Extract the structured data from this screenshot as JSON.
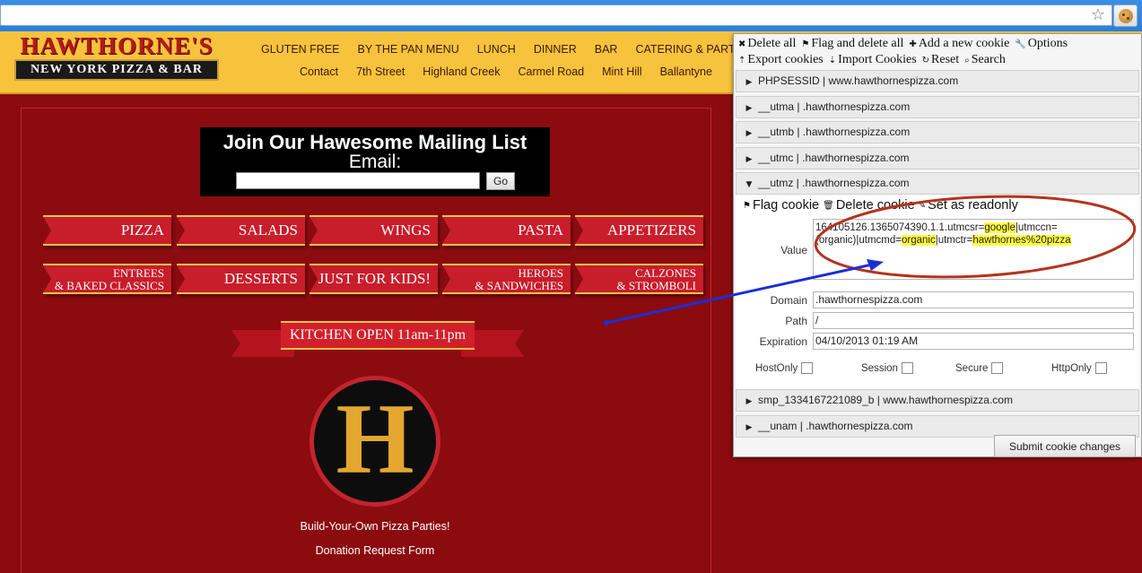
{
  "site": {
    "logo_top": "HAWTHORNE'S",
    "logo_bottom": "NEW YORK PIZZA & BAR",
    "nav_row1": [
      "GLUTEN FREE",
      "BY THE PAN MENU",
      "LUNCH",
      "DINNER",
      "BAR",
      "CATERING & PARTIES"
    ],
    "nav_row2": [
      "Contact",
      "7th Street",
      "Highland Creek",
      "Carmel Road",
      "Mint Hill",
      "Ballantyne"
    ],
    "mailing": {
      "title": "Join Our Hawesome Mailing List",
      "email_label": "Email:",
      "go_label": "Go"
    },
    "menu_row1": [
      "PIZZA",
      "SALADS",
      "WINGS",
      "PASTA",
      "APPETIZERS"
    ],
    "menu_row2": [
      {
        "l1": "ENTREES",
        "l2": "& BAKED CLASSICS"
      },
      {
        "l1": "DESSERTS",
        "l2": ""
      },
      {
        "l1": "JUST FOR KIDS!",
        "l2": ""
      },
      {
        "l1": "HEROES",
        "l2": "& SANDWICHES"
      },
      {
        "l1": "CALZONES",
        "l2": "& STROMBOLI"
      }
    ],
    "kitchen": "KITCHEN OPEN 11am-11pm",
    "h_letter": "H",
    "party_link": "Build-Your-Own Pizza Parties!",
    "donation_link": "Donation Request Form"
  },
  "panel": {
    "toolbar1": [
      {
        "icon": "✖",
        "label": "Delete all"
      },
      {
        "icon": "⚑",
        "label": "Flag and delete all"
      },
      {
        "icon": "✚",
        "label": "Add a new cookie"
      },
      {
        "icon": "🔧",
        "label": "Options"
      }
    ],
    "toolbar2": [
      {
        "icon": "⇡",
        "label": "Export cookies"
      },
      {
        "icon": "⇣",
        "label": "Import Cookies"
      },
      {
        "icon": "↻",
        "label": "Reset"
      },
      {
        "icon": "⌕",
        "label": "Search"
      }
    ],
    "cookies": [
      "PHPSESSID | www.hawthornespizza.com",
      "__utma | .hawthornespizza.com",
      "__utmb | .hawthornespizza.com",
      "__utmc | .hawthornespizza.com",
      "__utmz | .hawthornespizza.com"
    ],
    "cookies_after": [
      "smp_1334167221089_b | www.hawthornespizza.com",
      "__unam | .hawthornespizza.com"
    ],
    "expanded": {
      "actions": [
        {
          "icon": "⚑",
          "label": "Flag cookie"
        },
        {
          "icon": "🗑",
          "label": "Delete cookie"
        },
        {
          "icon": "✎",
          "label": "Set as readonly"
        }
      ],
      "value_label": "Value",
      "value_parts": [
        {
          "t": "164105126.1365074390.1.1.utmcsr=",
          "hl": false
        },
        {
          "t": "google",
          "hl": true
        },
        {
          "t": "|utmccn=(organic)|utmcmd=",
          "hl": false
        },
        {
          "t": "organic",
          "hl": true
        },
        {
          "t": "|utmctr=",
          "hl": false
        },
        {
          "t": "hawthornes%20pizza",
          "hl": true
        }
      ],
      "domain_label": "Domain",
      "domain": ".hawthornespizza.com",
      "path_label": "Path",
      "path": "/",
      "expiration_label": "Expiration",
      "expiration": "04/10/2013 01:19 AM",
      "flags": [
        "HostOnly",
        "Session",
        "Secure",
        "HttpOnly"
      ]
    },
    "submit_label": "Submit cookie changes"
  },
  "colors": {
    "page_bg": "#8b0b0f",
    "header_bg": "#f7c33c",
    "menu_red": "#c81d2a",
    "gold": "#f0c24a",
    "annotation_red": "#b5331f",
    "annotation_blue": "#1a2ed8"
  }
}
